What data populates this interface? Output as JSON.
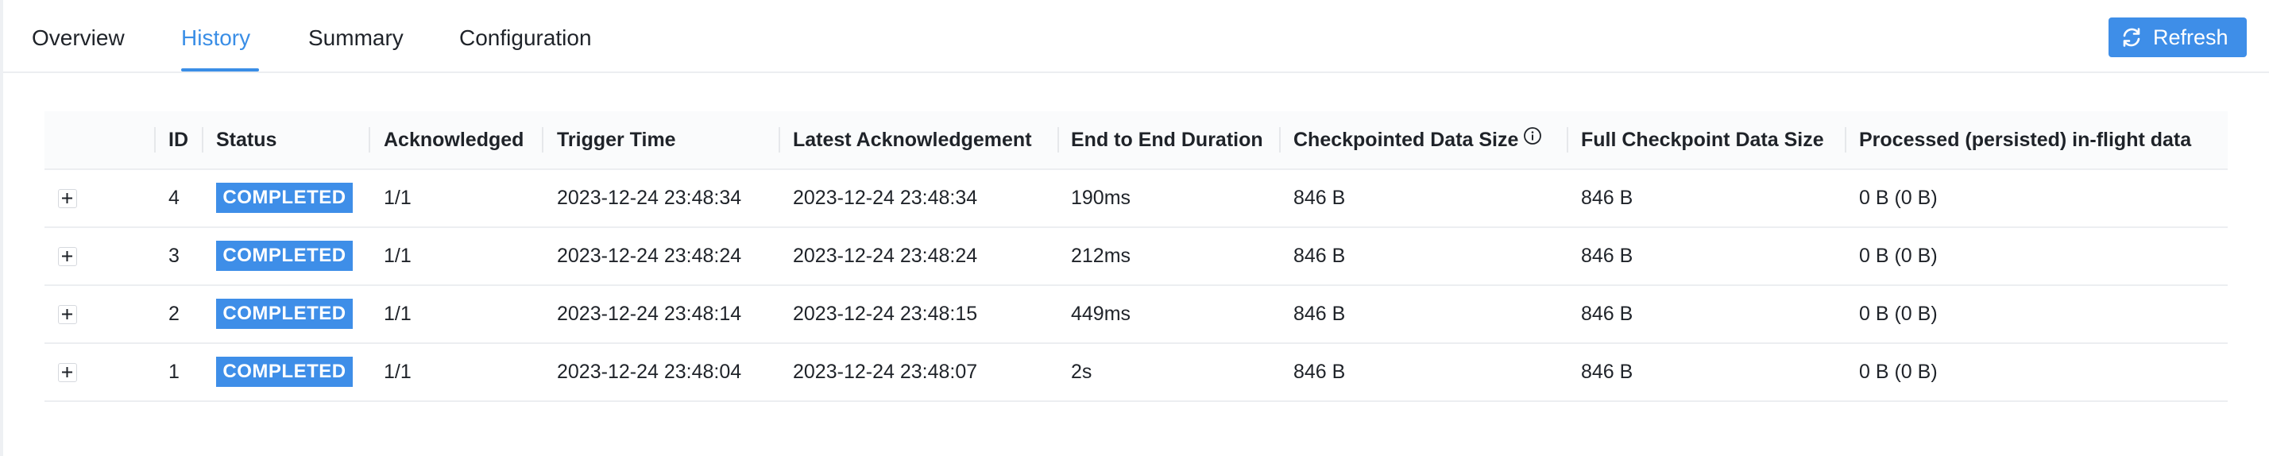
{
  "tabs": [
    {
      "label": "Overview",
      "active": false
    },
    {
      "label": "History",
      "active": true
    },
    {
      "label": "Summary",
      "active": false
    },
    {
      "label": "Configuration",
      "active": false
    }
  ],
  "refresh_button": {
    "label": "Refresh",
    "icon": "refresh-icon"
  },
  "table": {
    "columns": [
      "",
      "ID",
      "Status",
      "Acknowledged",
      "Trigger Time",
      "Latest Acknowledgement",
      "End to End Duration",
      "Checkpointed Data Size",
      "Full Checkpoint Data Size",
      "Processed (persisted) in-flight data"
    ],
    "rows": [
      {
        "id": "4",
        "status": "COMPLETED",
        "acknowledged": "1/1",
        "trigger_time": "2023-12-24 23:48:34",
        "latest_ack": "2023-12-24 23:48:34",
        "duration": "190ms",
        "checkpointed_size": "846 B",
        "full_size": "846 B",
        "inflight": "0 B (0 B)"
      },
      {
        "id": "3",
        "status": "COMPLETED",
        "acknowledged": "1/1",
        "trigger_time": "2023-12-24 23:48:24",
        "latest_ack": "2023-12-24 23:48:24",
        "duration": "212ms",
        "checkpointed_size": "846 B",
        "full_size": "846 B",
        "inflight": "0 B (0 B)"
      },
      {
        "id": "2",
        "status": "COMPLETED",
        "acknowledged": "1/1",
        "trigger_time": "2023-12-24 23:48:14",
        "latest_ack": "2023-12-24 23:48:15",
        "duration": "449ms",
        "checkpointed_size": "846 B",
        "full_size": "846 B",
        "inflight": "0 B (0 B)"
      },
      {
        "id": "1",
        "status": "COMPLETED",
        "acknowledged": "1/1",
        "trigger_time": "2023-12-24 23:48:04",
        "latest_ack": "2023-12-24 23:48:07",
        "duration": "2s",
        "checkpointed_size": "846 B",
        "full_size": "846 B",
        "inflight": "0 B (0 B)"
      }
    ]
  },
  "colors": {
    "accent": "#3e8ee8",
    "active_tab": "#3a8ee6",
    "text": "#1f2329"
  }
}
